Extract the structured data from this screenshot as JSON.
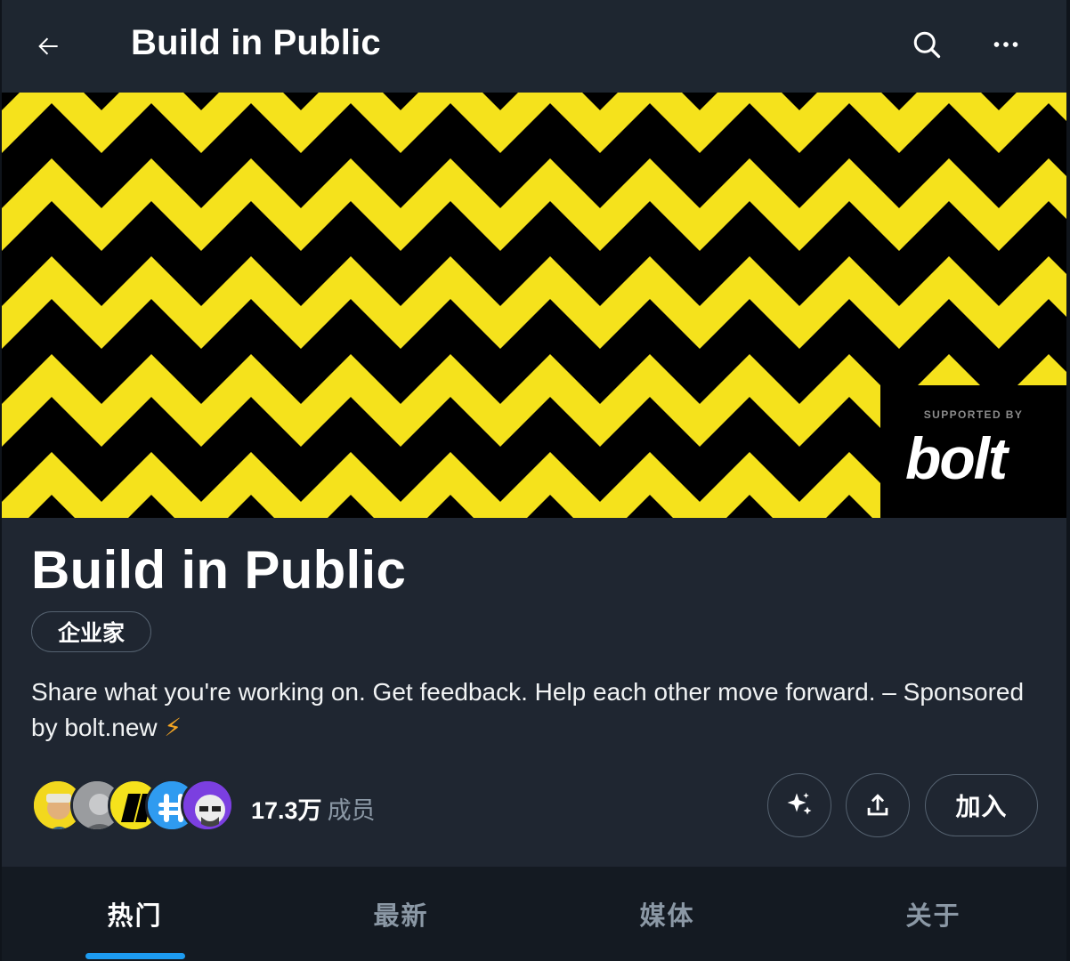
{
  "header": {
    "title": "Build in Public",
    "back_icon": "arrow-left-icon",
    "search_icon": "search-icon",
    "more_icon": "more-horizontal-icon"
  },
  "banner": {
    "colors": {
      "stripe": "#f5e21c",
      "background": "#000000"
    },
    "sponsor_small": "SUPPORTED BY",
    "sponsor_logo": "bolt"
  },
  "community": {
    "title": "Build in Public",
    "category": "企业家",
    "description": "Share what you're working on. Get feedback. Help each other move forward. – Sponsored by bolt.new",
    "description_emoji": "⚡",
    "member_count": "17.3万",
    "member_label": "成员",
    "join_label": "加入",
    "grok_icon": "sparkle-icon",
    "share_icon": "share-upload-icon"
  },
  "tabs": [
    {
      "label": "热门",
      "active": true
    },
    {
      "label": "最新",
      "active": false
    },
    {
      "label": "媒体",
      "active": false
    },
    {
      "label": "关于",
      "active": false
    }
  ],
  "colors": {
    "accent": "#1d9bf0",
    "background": "#1f2631",
    "tab_bar": "#141a22",
    "muted_text": "#8b98a5",
    "border": "#556270"
  }
}
